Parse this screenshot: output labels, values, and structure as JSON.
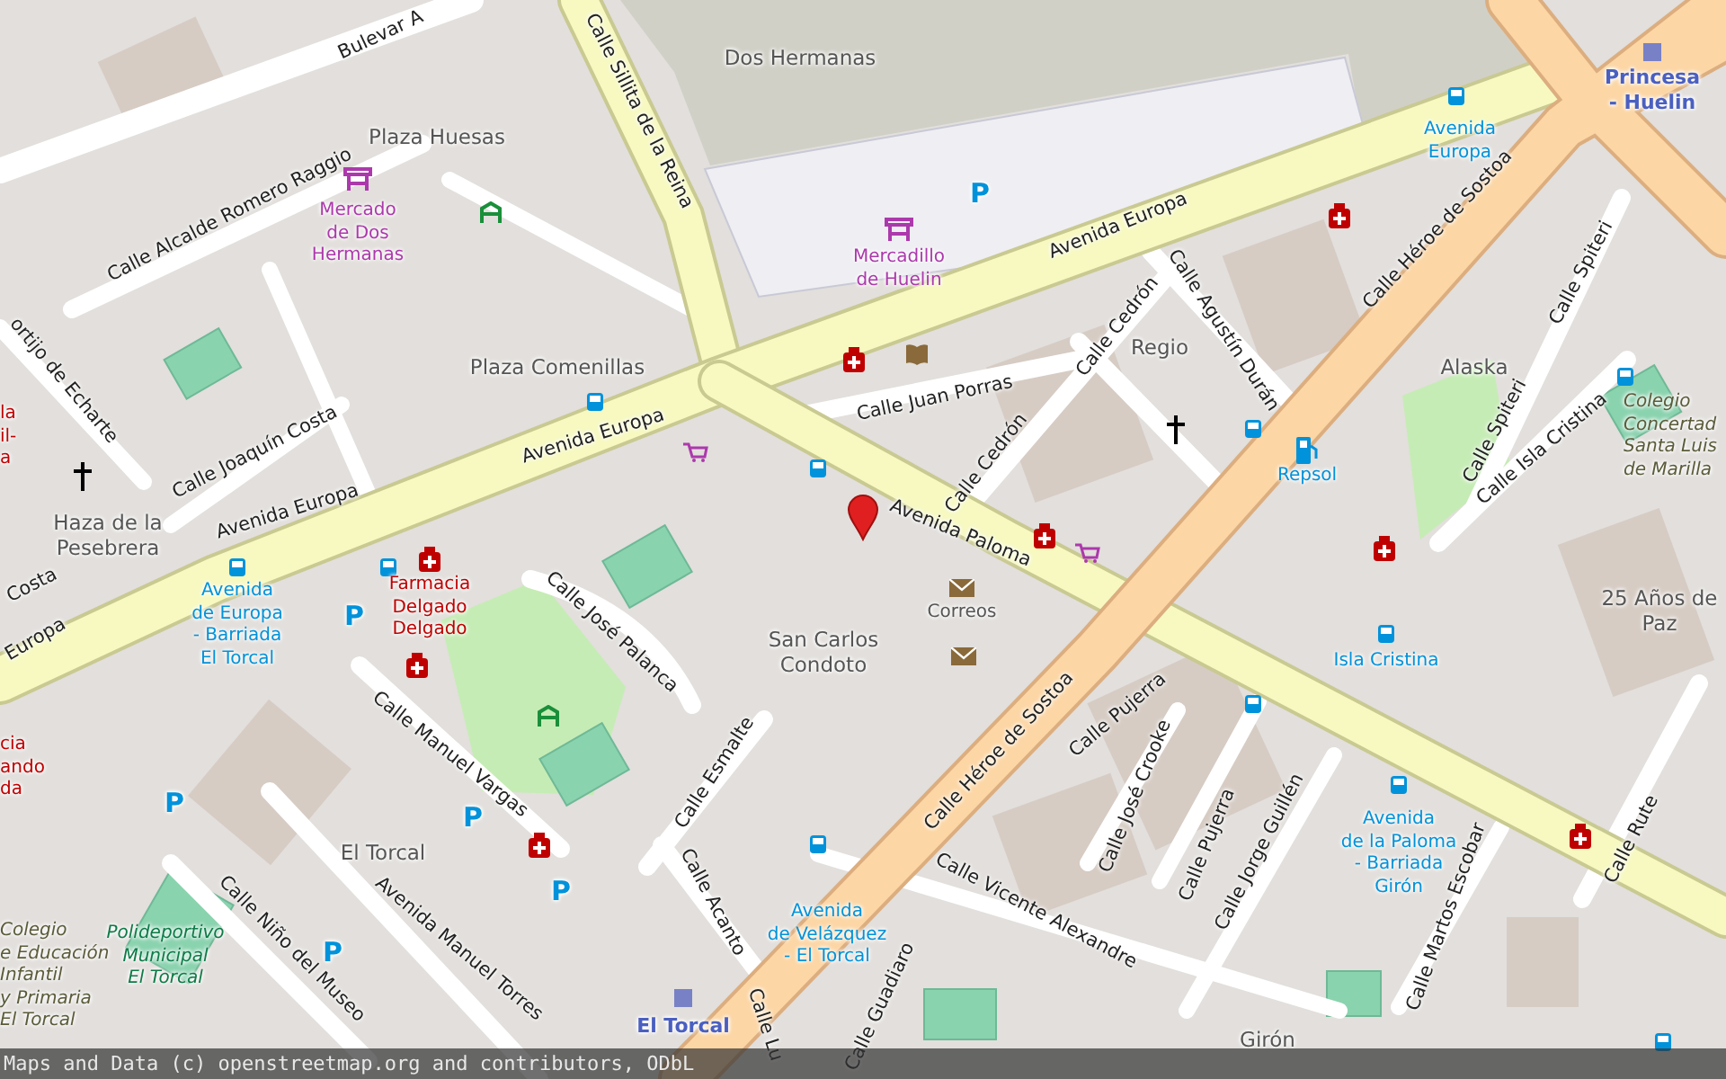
{
  "map": {
    "streets": [
      {
        "name": "Bulevar A"
      },
      {
        "name": "Calle Alcalde Romero Raggio"
      },
      {
        "name": "Calle Sillita de la Reina"
      },
      {
        "name": "Avenida Europa"
      },
      {
        "name": "Avenida Europa"
      },
      {
        "name": "Avenida Europa"
      },
      {
        "name": "Europa"
      },
      {
        "name": "Calle Juan Porras"
      },
      {
        "name": "Calle Cedrón"
      },
      {
        "name": "Calle Cedrón"
      },
      {
        "name": "Calle Agustín Durán"
      },
      {
        "name": "Calle Héroe de Sostoa"
      },
      {
        "name": "Calle Héroe de Sostoa"
      },
      {
        "name": "Avenida Paloma"
      },
      {
        "name": "Calle Spiteri"
      },
      {
        "name": "Calle Spiteri"
      },
      {
        "name": "Calle Isla Cristina"
      },
      {
        "name": "Calle Joaquín Costa"
      },
      {
        "name": "ortijo de Echarte"
      },
      {
        "name": "Costa"
      },
      {
        "name": "Calle José Palanca"
      },
      {
        "name": "Calle Manuel Vargas"
      },
      {
        "name": "Calle Esmalte"
      },
      {
        "name": "Calle Acanto"
      },
      {
        "name": "Calle Niño del Museo"
      },
      {
        "name": "Avenida Manuel Torres"
      },
      {
        "name": "Calle Pujerra"
      },
      {
        "name": "Calle José Crooke"
      },
      {
        "name": "Calle Pujerra"
      },
      {
        "name": "Calle Jorge Guillén"
      },
      {
        "name": "Calle Vicente Alexandre"
      },
      {
        "name": "Calle Martos Escobar"
      },
      {
        "name": "Calle Rute"
      },
      {
        "name": "Calle Guadiaro"
      },
      {
        "name": "Calle Lu"
      }
    ],
    "places": [
      {
        "lines": [
          "Dos Hermanas"
        ]
      },
      {
        "lines": [
          "Plaza Huesas"
        ]
      },
      {
        "lines": [
          "Plaza Comenillas"
        ]
      },
      {
        "lines": [
          "Regio"
        ]
      },
      {
        "lines": [
          "Alaska"
        ]
      },
      {
        "lines": [
          "Haza de la",
          "Pesebrera"
        ]
      },
      {
        "lines": [
          "San Carlos",
          "Condoto"
        ]
      },
      {
        "lines": [
          "El Torcal"
        ]
      },
      {
        "lines": [
          "25 Años de",
          "Paz"
        ]
      },
      {
        "lines": [
          "Girón"
        ]
      }
    ],
    "pois": [
      {
        "kind": "transit",
        "lines": [
          "Avenida",
          "Europa"
        ]
      },
      {
        "kind": "transit",
        "lines": [
          "Avenida",
          "de Europa",
          "- Barriada",
          "El Torcal"
        ]
      },
      {
        "kind": "transit",
        "lines": [
          "Avenida",
          "de Velázquez",
          "- El Torcal"
        ]
      },
      {
        "kind": "transit",
        "lines": [
          "Isla Cristina"
        ]
      },
      {
        "kind": "transit",
        "lines": [
          "Avenida",
          "de la Paloma",
          "- Barriada",
          "Girón"
        ]
      },
      {
        "kind": "transit",
        "lines": [
          "Repsol"
        ]
      },
      {
        "kind": "market",
        "lines": [
          "Mercado",
          "de Dos",
          "Hermanas"
        ]
      },
      {
        "kind": "market",
        "lines": [
          "Mercadillo",
          "de Huelin"
        ]
      },
      {
        "kind": "health",
        "lines": [
          "Farmacia",
          "Delgado",
          "Delgado"
        ]
      },
      {
        "kind": "health",
        "lines": [
          "la",
          "il-",
          "a"
        ]
      },
      {
        "kind": "health",
        "lines": [
          "cia",
          "ando",
          "da"
        ]
      },
      {
        "kind": "post",
        "lines": [
          "Correos"
        ]
      },
      {
        "kind": "station",
        "lines": [
          "Princesa",
          "- Huelin"
        ]
      },
      {
        "kind": "station",
        "lines": [
          "El Torcal"
        ]
      },
      {
        "kind": "school",
        "lines": [
          "Colegio",
          "Concertad",
          "Santa Luis",
          "de Marilla"
        ]
      },
      {
        "kind": "school",
        "lines": [
          "Colegio",
          "e Educación",
          "Infantil",
          "y Primaria",
          "El Torcal"
        ]
      },
      {
        "kind": "sport",
        "lines": [
          "Polideportivo",
          "Municipal",
          "El Torcal"
        ]
      }
    ],
    "parking": [
      "P",
      "P",
      "P",
      "P",
      "P",
      "P"
    ]
  },
  "attribution": "Maps and Data (c) openstreetmap.org and contributors, ODbL"
}
